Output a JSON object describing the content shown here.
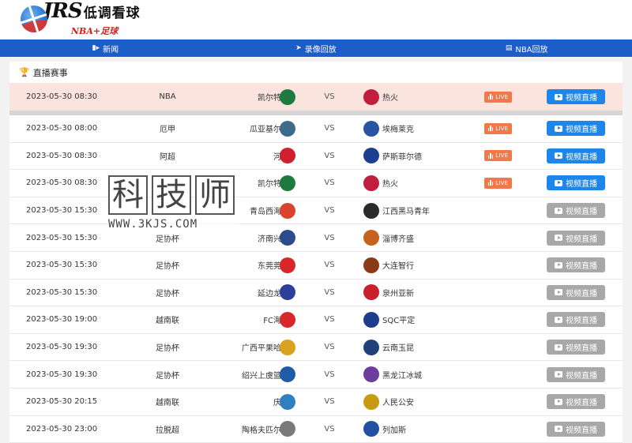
{
  "brand": {
    "name": "JRS",
    "name_cn": "低调看球",
    "tagline": "NBA+足球"
  },
  "nav": [
    {
      "label": "新闻",
      "icon": "video-camera-icon"
    },
    {
      "label": "录像回放",
      "icon": "rocket-icon"
    },
    {
      "label": "NBA回放",
      "icon": "monitor-icon"
    }
  ],
  "section": {
    "title": "直播赛事",
    "icon": "trophy-icon"
  },
  "live_label": "LIVE",
  "button_label": "视频直播",
  "vs_label": "VS",
  "featured": {
    "time": "2023-05-30 08:30",
    "league": "NBA",
    "home": "凯尔特人",
    "away": "热火",
    "home_color": "#1f7a3f",
    "away_color": "#c01e3c",
    "live": true,
    "button_state": "active"
  },
  "matches": [
    {
      "time": "2023-05-30 08:00",
      "league": "厄甲",
      "home": "瓜亚基尔城",
      "away": "埃梅莱克",
      "home_color": "#3d6b8c",
      "away_color": "#2954a3",
      "live": true,
      "button_state": "active"
    },
    {
      "time": "2023-05-30 08:30",
      "league": "阿超",
      "home": "河床",
      "away": "萨斯菲尔德",
      "home_color": "#d0202e",
      "away_color": "#1c3f8f",
      "live": true,
      "button_state": "active"
    },
    {
      "time": "2023-05-30 08:30",
      "league": "",
      "home": "凯尔特人",
      "away": "热火",
      "home_color": "#1f7a3f",
      "away_color": "#c01e3c",
      "live": true,
      "button_state": "active"
    },
    {
      "time": "2023-05-30 15:30",
      "league": "",
      "home": "青岛西海岸",
      "away": "江西黑马青年",
      "home_color": "#d8452c",
      "away_color": "#2a2a2a",
      "live": false,
      "button_state": "inactive"
    },
    {
      "time": "2023-05-30 15:30",
      "league": "足协杯",
      "home": "济南兴洲",
      "away": "淄博齐盛",
      "home_color": "#2b4d8c",
      "away_color": "#c4621e",
      "live": false,
      "button_state": "inactive"
    },
    {
      "time": "2023-05-30 15:30",
      "league": "足协杯",
      "home": "东莞莞联",
      "away": "大连智行",
      "home_color": "#d8262a",
      "away_color": "#8c3a16",
      "live": false,
      "button_state": "inactive"
    },
    {
      "time": "2023-05-30 15:30",
      "league": "足协杯",
      "home": "延边龙鼎",
      "away": "泉州亚新",
      "home_color": "#2c3f9a",
      "away_color": "#c8202c",
      "live": false,
      "button_state": "inactive"
    },
    {
      "time": "2023-05-30 19:00",
      "league": "越南联",
      "home": "FC海防",
      "away": "SQC平定",
      "home_color": "#d7262c",
      "away_color": "#1e3c8c",
      "live": false,
      "button_state": "inactive"
    },
    {
      "time": "2023-05-30 19:30",
      "league": "足协杯",
      "home": "广西平果哈嘹",
      "away": "云南玉昆",
      "home_color": "#d9a21c",
      "away_color": "#22407a",
      "live": false,
      "button_state": "inactive"
    },
    {
      "time": "2023-05-30 19:30",
      "league": "足协杯",
      "home": "绍兴上虞篮龙",
      "away": "黑龙江冰城",
      "home_color": "#1e5ba8",
      "away_color": "#6a3e9a",
      "live": false,
      "button_state": "inactive"
    },
    {
      "time": "2023-05-30 20:15",
      "league": "越南联",
      "home": "庆和",
      "away": "人民公安",
      "home_color": "#2f7fc2",
      "away_color": "#c69a12",
      "live": false,
      "button_state": "inactive"
    },
    {
      "time": "2023-05-30 23:00",
      "league": "拉脱超",
      "home": "陶格夫匹尔斯",
      "away": "列加斯",
      "home_color": "#7a7a7a",
      "away_color": "#2251a3",
      "live": false,
      "button_state": "inactive"
    }
  ],
  "watermark": {
    "chars": [
      "科",
      "技",
      "师"
    ],
    "url": "WWW.3KJS.COM"
  },
  "colors": {
    "nav_bg": "#1d5dc8",
    "live_bg": "#f2784b",
    "button_active": "#1e86e8",
    "button_inactive": "#a8a8a8",
    "featured_bg": "#fbe3de"
  }
}
